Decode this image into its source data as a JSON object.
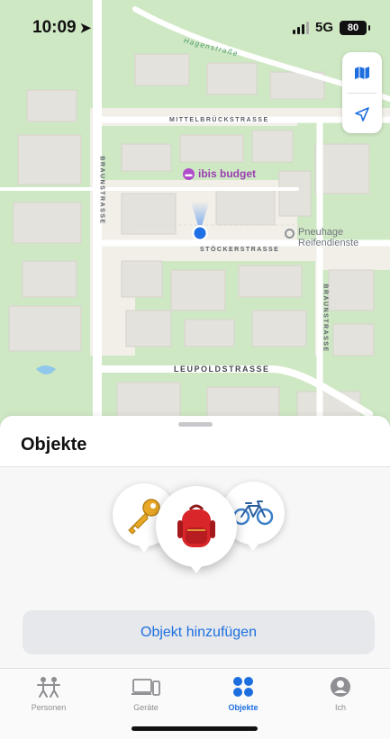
{
  "status_bar": {
    "time": "10:09",
    "network": "5G",
    "battery": "80"
  },
  "map": {
    "street_labels": {
      "hegnstrasse": "Hagenstraße",
      "mittelbruckstrasse": "MITTELBRÜCKSTRASSE",
      "braunstrasse_left": "BRAUNSTRASSE",
      "stoeckerstrasse": "STÖCKERSTRASSE",
      "braunstrasse_right": "BRAUNSTRASSE",
      "leupoldstrasse": "LEUPOLDSTRASSE"
    },
    "poi_ibis": "ibis budget",
    "poi_pneuhage_line1": "Pneuhage",
    "poi_pneuhage_line2": "Reifendienste"
  },
  "sheet": {
    "title": "Objekte",
    "items": [
      "key",
      "backpack",
      "bicycle"
    ],
    "add_button_label": "Objekt hinzufügen"
  },
  "tab_bar": {
    "tabs": [
      {
        "label": "Personen",
        "icon": "people-icon"
      },
      {
        "label": "Geräte",
        "icon": "devices-icon"
      },
      {
        "label": "Objekte",
        "icon": "items-icon",
        "active": true
      },
      {
        "label": "Ich",
        "icon": "person-icon"
      }
    ]
  },
  "colors": {
    "accent": "#1d6fe0",
    "map_green": "#cfe8c4",
    "map_base": "#f1efe8"
  }
}
